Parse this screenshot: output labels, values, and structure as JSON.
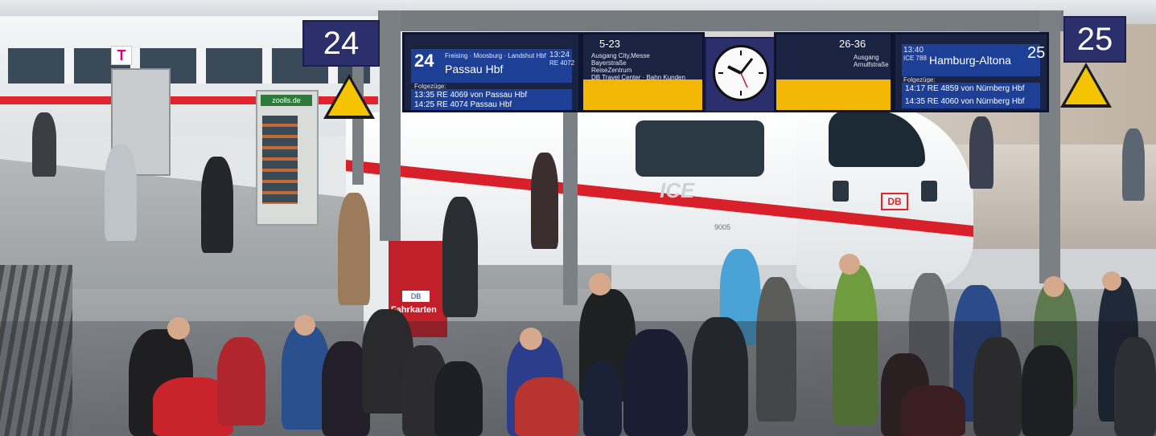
{
  "platform_left": "24",
  "platform_right": "25",
  "board_left": {
    "track": "24",
    "via": "Freising · Moosburg · Landshut Hbf",
    "time": "13:24",
    "train": "RE 4072",
    "destination": "Passau Hbf",
    "follow_label": "Folgezüge:",
    "follow1": "13:35   RE 4069  von Passau Hbf",
    "follow2": "14:25   RE 4074  Passau Hbf"
  },
  "board_mid_left": {
    "range": "5-23",
    "info1": "Ausgang City,Messe",
    "info2": "Bayerstraße",
    "info3": "ReiseZentrum",
    "info4": "DB Travel Center · Bahn Kunden"
  },
  "board_mid_right": {
    "range": "26-36",
    "info1": "Ausgang",
    "info2": "Arnulfstraße"
  },
  "board_right": {
    "time": "13:40",
    "train": "ICE 788",
    "destination": "Hamburg-Altona",
    "track": "25",
    "follow_label": "Folgezüge:",
    "follow1": "14:17   RE 4859  von Nürnberg Hbf",
    "follow2": "14:35   RE 4060  von Nürnberg Hbf"
  },
  "train_logo": "ICE",
  "train_db": "DB",
  "train_number": "9005",
  "vending_label": "zoolls.de",
  "telekom": "T",
  "kiosk_label": "Fahrkarten",
  "kiosk_db": "DB"
}
